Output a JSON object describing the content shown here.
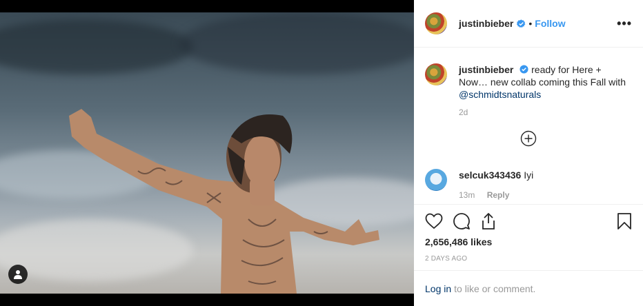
{
  "media": {
    "tag_icon": "person-tag-icon"
  },
  "header": {
    "username": "justinbieber",
    "separator": "•",
    "follow_label": "Follow",
    "more_label": "•••"
  },
  "caption": {
    "username": "justinbieber",
    "text": "ready for Here + Now… new collab coming this Fall with",
    "mention": "@schmidtsnaturals",
    "time": "2d"
  },
  "comments": [
    {
      "username": "selcuk343436",
      "text": "Iyi",
      "time": "13m",
      "reply_label": "Reply"
    }
  ],
  "actions": {
    "likes": "2,656,486 likes",
    "age": "2 days ago"
  },
  "login": {
    "link": "Log in",
    "text": "to like or comment."
  },
  "colors": {
    "accent": "#3897f0",
    "mention": "#003569",
    "muted": "#999999"
  }
}
